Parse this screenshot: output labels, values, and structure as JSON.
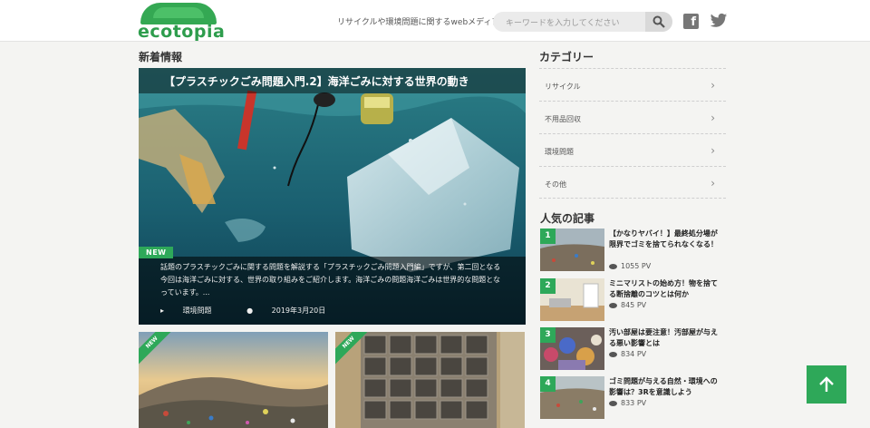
{
  "header": {
    "logo_text": "ecotopia",
    "tagline": "リサイクルや環境問題に関するwebメディア",
    "search_placeholder": "キーワードを入力してください"
  },
  "main": {
    "section_title": "新着情報",
    "featured": {
      "title": "【プラスチックごみ問題入門.2】海洋ごみに対する世界の動き",
      "badge": "NEW",
      "excerpt": "話題のプラスチックごみに関する問題を解説する「プラスチックごみ問題入門編」ですが、第二回となる今回は海洋ごみに対する、世界の取り組みをご紹介します。海洋ごみの問題海洋ごみは世界的な問題となっています。...",
      "category": "環境問題",
      "date": "2019年3月20日"
    },
    "cards": [
      {
        "badge": "NEW"
      },
      {
        "badge": "NEW"
      }
    ]
  },
  "sidebar": {
    "category_title": "カテゴリー",
    "categories": [
      {
        "label": "リサイクル"
      },
      {
        "label": "不用品回収"
      },
      {
        "label": "環境問題"
      },
      {
        "label": "その他"
      }
    ],
    "popular_title": "人気の記事",
    "popular": [
      {
        "rank": "1",
        "title": "【かなりヤバイ！】最終処分場が限界でゴミを捨てられなくなる！",
        "pv": "1055 PV"
      },
      {
        "rank": "2",
        "title": "ミニマリストの始め方！物を捨てる断捨離のコツとは何か",
        "pv": "845 PV"
      },
      {
        "rank": "3",
        "title": "汚い部屋は要注意！汚部屋が与える悪い影響とは",
        "pv": "834 PV"
      },
      {
        "rank": "4",
        "title": "ゴミ問題が与える自然・環境への影響は？3Rを意識しよう",
        "pv": "833 PV"
      }
    ]
  },
  "colors": {
    "accent": "#2ea859"
  }
}
